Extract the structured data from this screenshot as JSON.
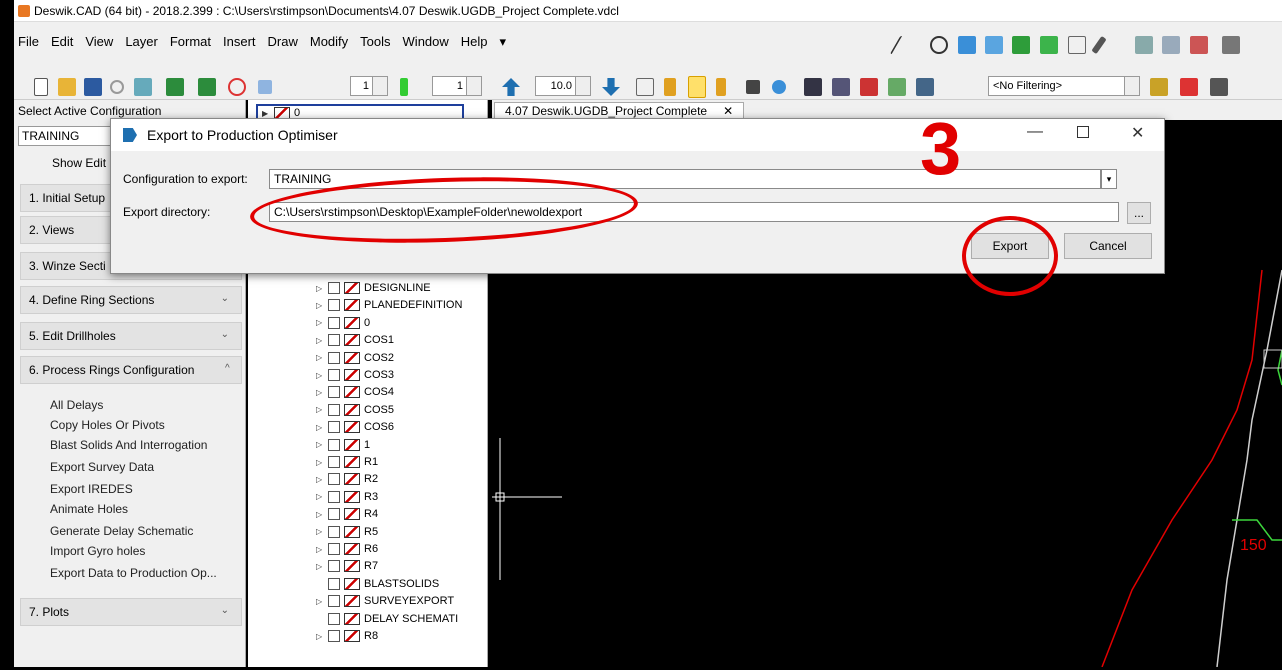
{
  "window": {
    "title": "Deswik.CAD (64 bit) - 2018.2.399 : C:\\Users\\rstimpson\\Documents\\4.07 Deswik.UGDB_Project Complete.vdcl"
  },
  "menu": [
    "File",
    "Edit",
    "View",
    "Layer",
    "Format",
    "Insert",
    "Draw",
    "Modify",
    "Tools",
    "Window",
    "Help",
    "▾"
  ],
  "toolbar": {
    "spin1": "1",
    "spin2": "1",
    "zoom": "10.0",
    "filter": "<No Filtering>"
  },
  "left": {
    "config_label": "Select Active Configuration",
    "config_value": "TRAINING",
    "show_edit": "Show Edit",
    "sections": [
      "1. Initial Setup",
      "2. Views",
      "3. Winze Secti",
      "4. Define Ring Sections",
      "5. Edit Drillholes",
      "6. Process Rings Configuration",
      "7. Plots"
    ],
    "subitems": [
      "All Delays",
      "Copy Holes Or Pivots",
      "Blast Solids And Interrogation",
      "Export Survey Data",
      "Export IREDES",
      "Animate Holes",
      "Generate Delay Schematic",
      "Import Gyro holes",
      "Export Data to Production Op..."
    ]
  },
  "tree": {
    "header_value": "0",
    "layers": [
      "DESIGNLINE",
      "PLANEDEFINITION",
      "0",
      "COS1",
      "COS2",
      "COS3",
      "COS4",
      "COS5",
      "COS6",
      "1",
      "R1",
      "R2",
      "R3",
      "R4",
      "R5",
      "R6",
      "R7",
      "BLASTSOLIDS",
      "SURVEYEXPORT",
      "DELAY SCHEMATI",
      "R8"
    ]
  },
  "doc_tab": "4.07 Deswik.UGDB_Project Complete",
  "dialog": {
    "title": "Export to Production Optimiser",
    "config_label": "Configuration to export:",
    "config_value": "TRAINING",
    "dir_label": "Export directory:",
    "dir_value": "C:\\Users\\rstimpson\\Desktop\\ExampleFolder\\newoldexport",
    "browse": "...",
    "export": "Export",
    "cancel": "Cancel"
  },
  "annotation": {
    "step": "3"
  },
  "canvas_label": "150"
}
